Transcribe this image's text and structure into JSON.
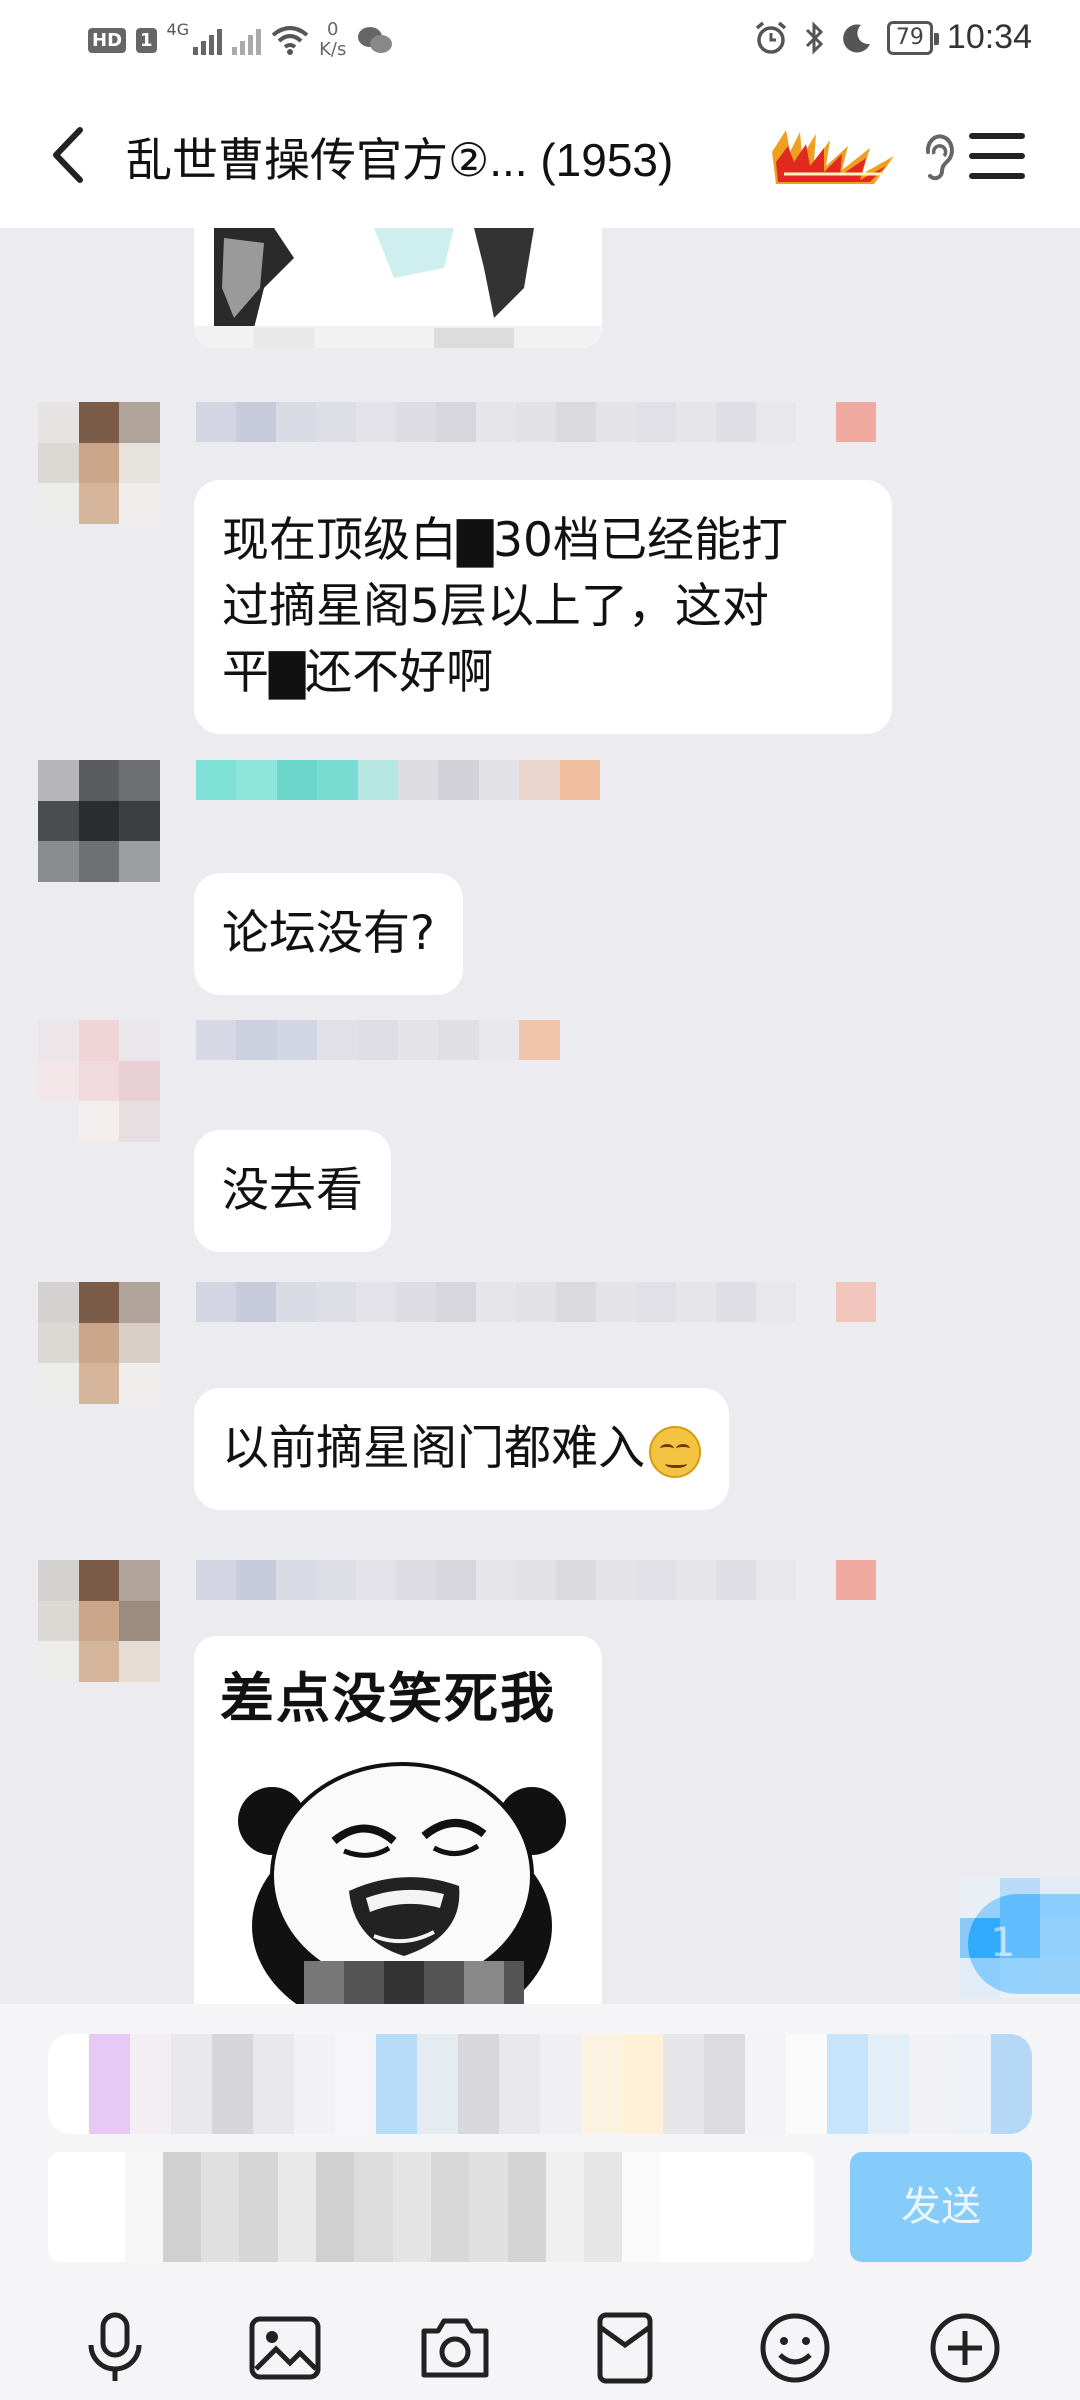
{
  "status_bar": {
    "hd_badge": "HD",
    "sim_badge": "1",
    "network": "4G",
    "net_speed_value": "0",
    "net_speed_unit": "K/s",
    "battery": "79",
    "time": "10:34"
  },
  "header": {
    "title": "乱世曹操传官方②... (1953)",
    "badge_icon": "level-badge-logo"
  },
  "messages": [
    {
      "type": "text",
      "lines": [
        "现在顶级白▇30档已经能打",
        "过摘星阁5层以上了，这对",
        "平▇还不好啊"
      ]
    },
    {
      "type": "text",
      "lines": [
        "论坛没有?"
      ]
    },
    {
      "type": "text",
      "lines": [
        "没去看"
      ]
    },
    {
      "type": "text",
      "lines": [
        "以前摘星阁门都难入"
      ],
      "emoji": "smirk-emoji"
    },
    {
      "type": "sticker",
      "caption": "差点没笑死我"
    }
  ],
  "unread_badge": "1",
  "input": {
    "send_label": "发送"
  },
  "toolbar": {
    "icons": [
      "microphone-icon",
      "image-icon",
      "camera-icon",
      "red-packet-icon",
      "emoji-icon",
      "plus-icon"
    ]
  },
  "colors": {
    "chat_background": "#ebebf0",
    "bubble": "#ffffff",
    "send_button": "#86ccfb",
    "unread_badge": "#2aa6ff"
  }
}
